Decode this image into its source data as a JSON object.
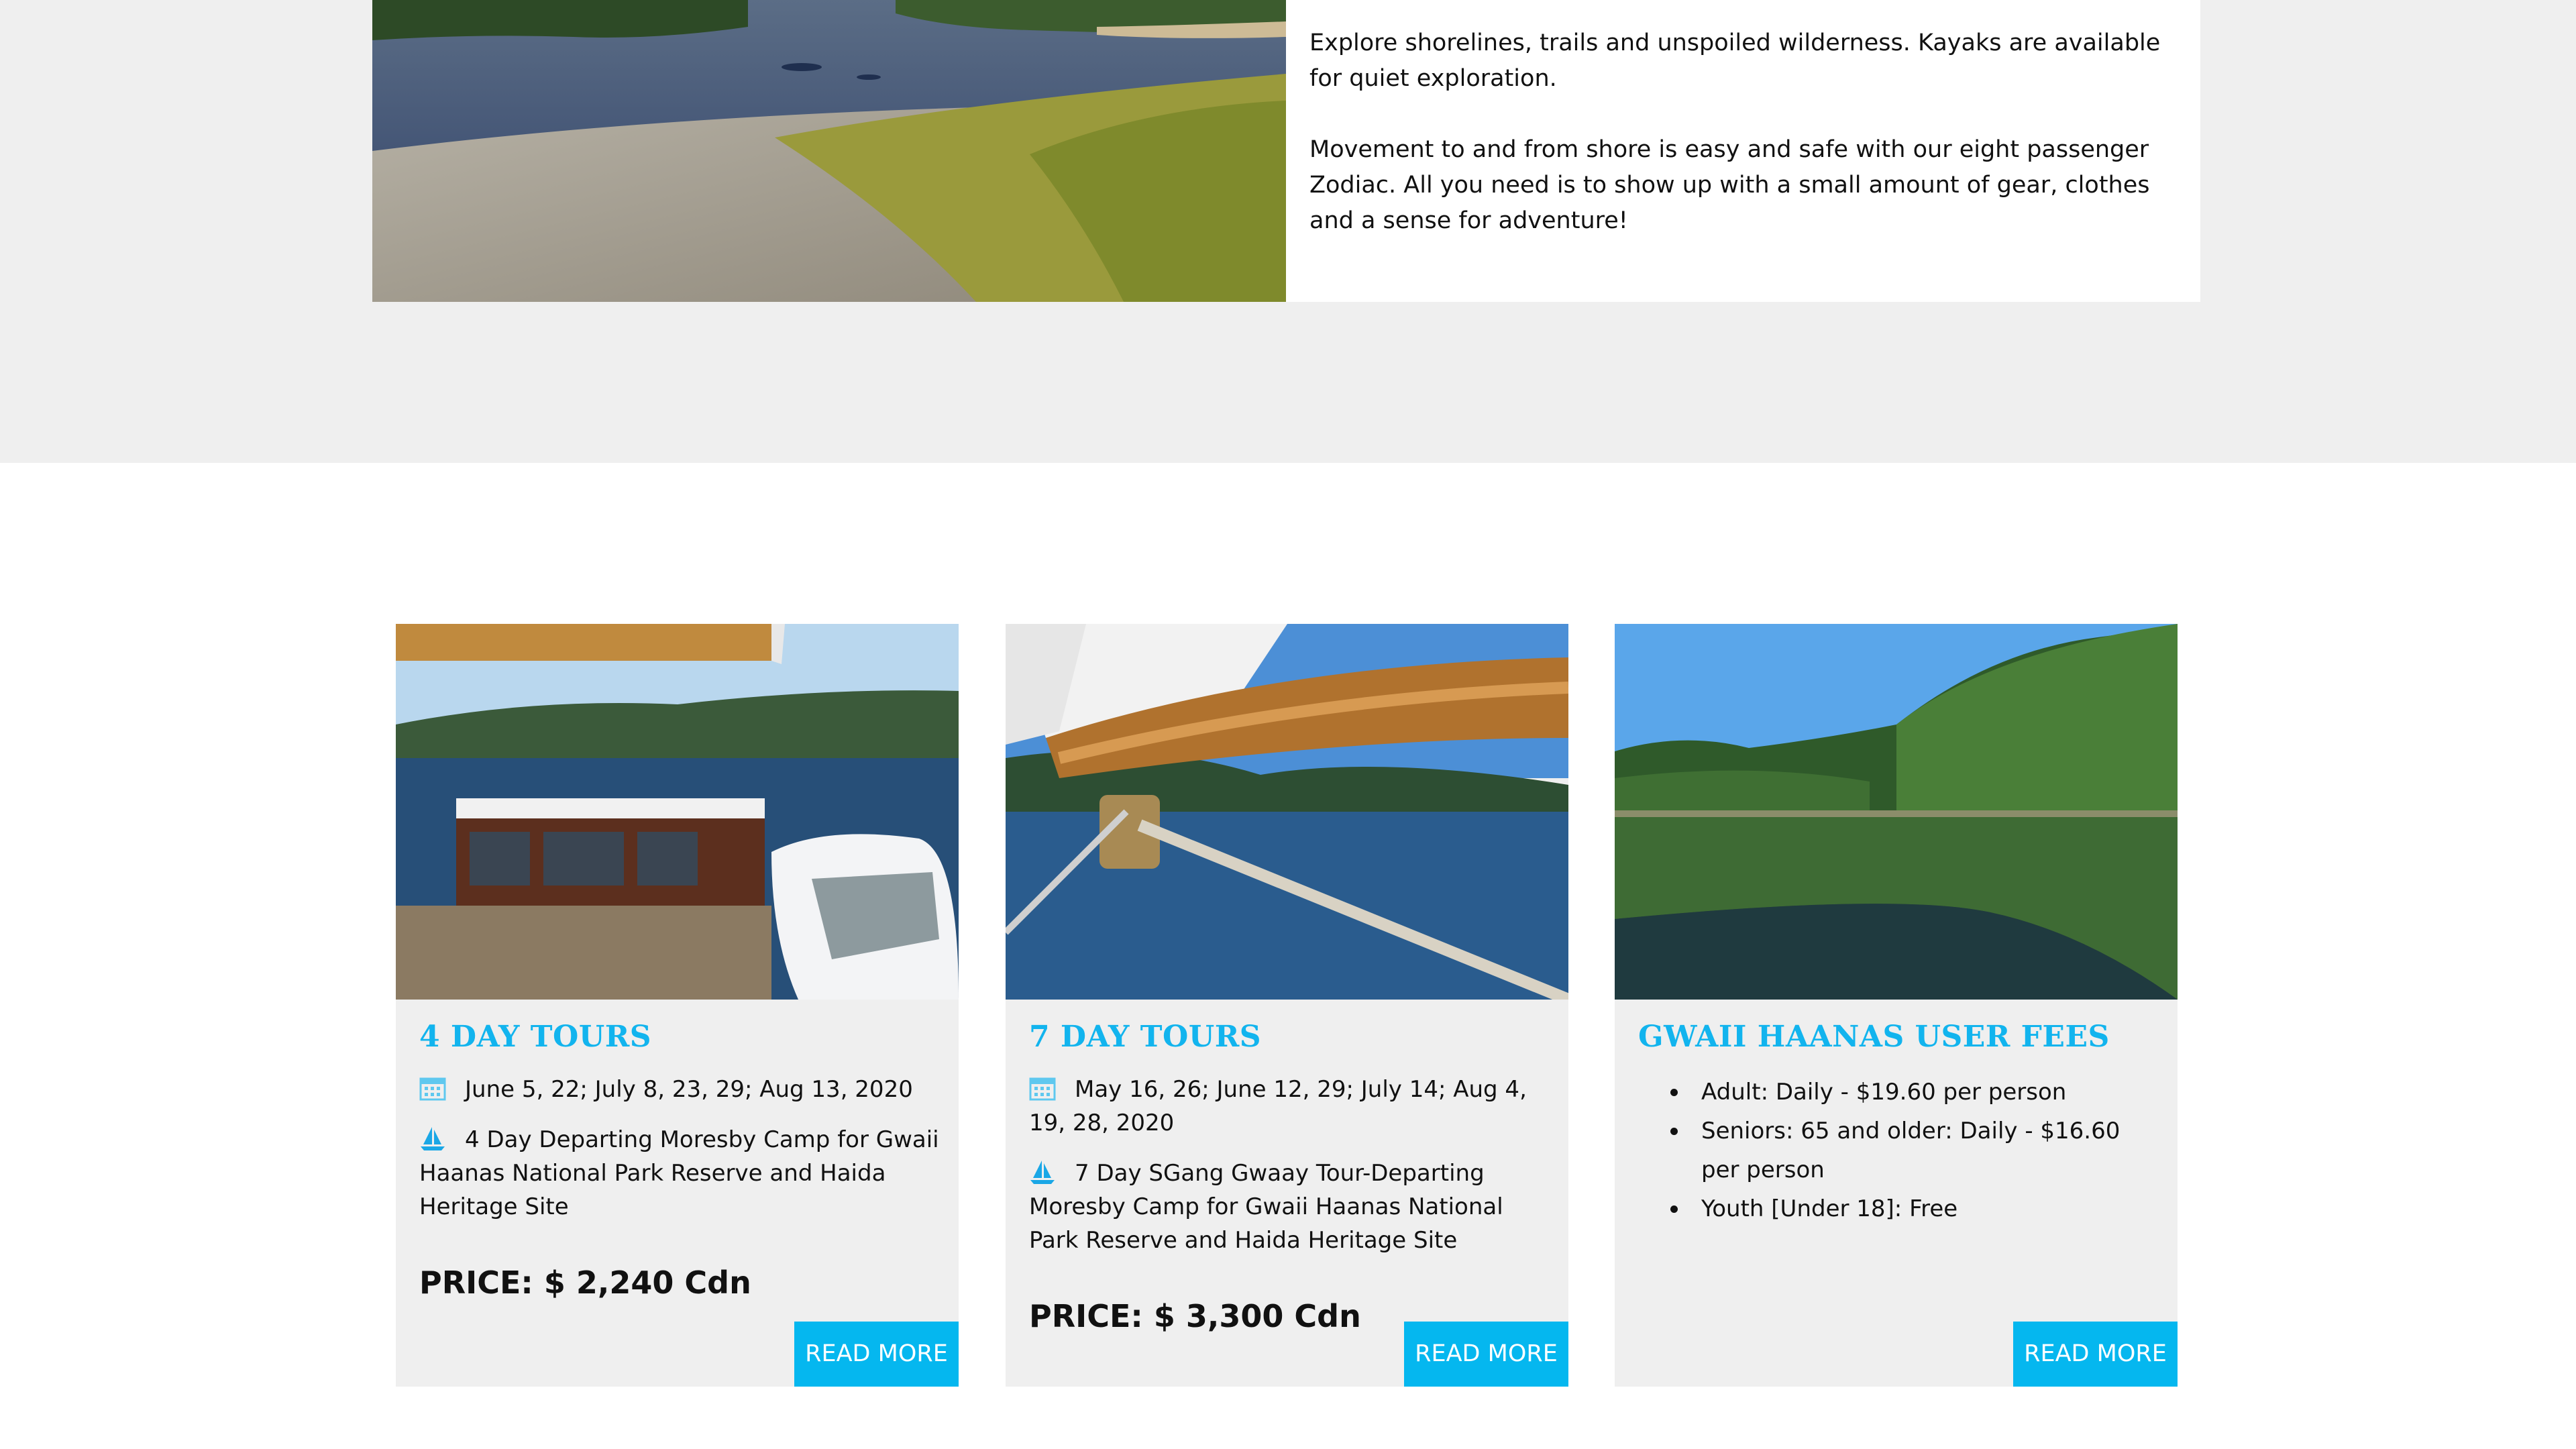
{
  "intro": {
    "paragraphs": [
      "Explore shorelines, trails and unspoiled wilderness. Kayaks are available for quiet exploration.",
      "Movement to and from shore is easy and safe with our eight passenger Zodiac. All you need is to show up with a small amount of gear, clothes and a sense for adventure!"
    ]
  },
  "cards": [
    {
      "title": "4 DAY TOURS",
      "dates": "June 5, 22; July 8, 23, 29; Aug 13, 2020",
      "description": "4 Day Departing Moresby Camp for Gwaii Haanas National Park Reserve and Haida Heritage Site",
      "price": "PRICE: $ 2,240 Cdn",
      "button": "READ MORE"
    },
    {
      "title": "7 DAY TOURS",
      "dates": "May 16, 26; June 12, 29; July 14; Aug 4, 19, 28, 2020",
      "description": "7 Day SGang Gwaay Tour-Departing Moresby Camp for Gwaii Haanas National Park Reserve and Haida Heritage Site",
      "price": "PRICE: $ 3,300 Cdn",
      "button": "READ MORE"
    },
    {
      "title": "GWAII HAANAS USER FEES",
      "fees": [
        "Adult: Daily - $19.60 per person",
        "Seniors: 65 and older: Daily - $16.60 per person",
        "Youth [Under 18]: Free"
      ],
      "button": "READ MORE"
    }
  ],
  "icons": {
    "dates": "calendar-icon",
    "trip": "sailboat-icon"
  },
  "colors": {
    "accent": "#12b4ee",
    "button": "#05b7ef",
    "panel": "#efefef"
  }
}
